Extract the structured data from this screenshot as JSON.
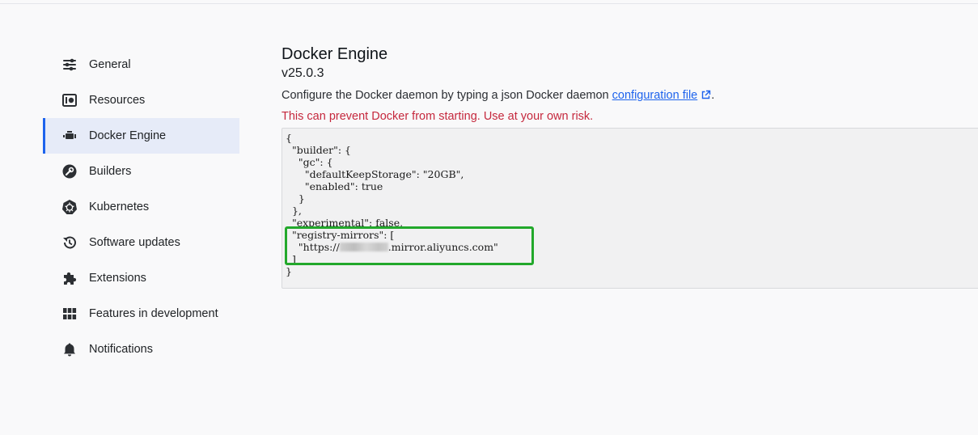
{
  "sidebar": {
    "items": [
      {
        "label": "General",
        "icon": "sliders-icon"
      },
      {
        "label": "Resources",
        "icon": "resources-icon"
      },
      {
        "label": "Docker Engine",
        "icon": "engine-icon",
        "active": true
      },
      {
        "label": "Builders",
        "icon": "wrench-icon"
      },
      {
        "label": "Kubernetes",
        "icon": "kubernetes-icon"
      },
      {
        "label": "Software updates",
        "icon": "history-icon"
      },
      {
        "label": "Extensions",
        "icon": "puzzle-icon"
      },
      {
        "label": "Features in development",
        "icon": "grid-icon"
      },
      {
        "label": "Notifications",
        "icon": "bell-icon"
      }
    ]
  },
  "main": {
    "title": "Docker Engine",
    "version": "v25.0.3",
    "description_prefix": "Configure the Docker daemon by typing a json Docker daemon ",
    "config_link": "configuration file",
    "description_suffix": ".",
    "warning": "This can prevent Docker from starting. Use at your own risk."
  },
  "editor": {
    "lines": [
      "{",
      "  \"builder\": {",
      "    \"gc\": {",
      "      \"defaultKeepStorage\": \"20GB\",",
      "      \"enabled\": true",
      "    }",
      "  },",
      "  \"experimental\": false,",
      "  \"registry-mirrors\": [",
      "    \"https://",
      "  ]",
      "}"
    ],
    "mirror_suffix": ".mirror.aliyuncs.com\"",
    "highlight_color": "#22a82b"
  },
  "colors": {
    "accent": "#1d63ed",
    "warning": "#c5283d",
    "active_bg": "#e6ebf8"
  }
}
